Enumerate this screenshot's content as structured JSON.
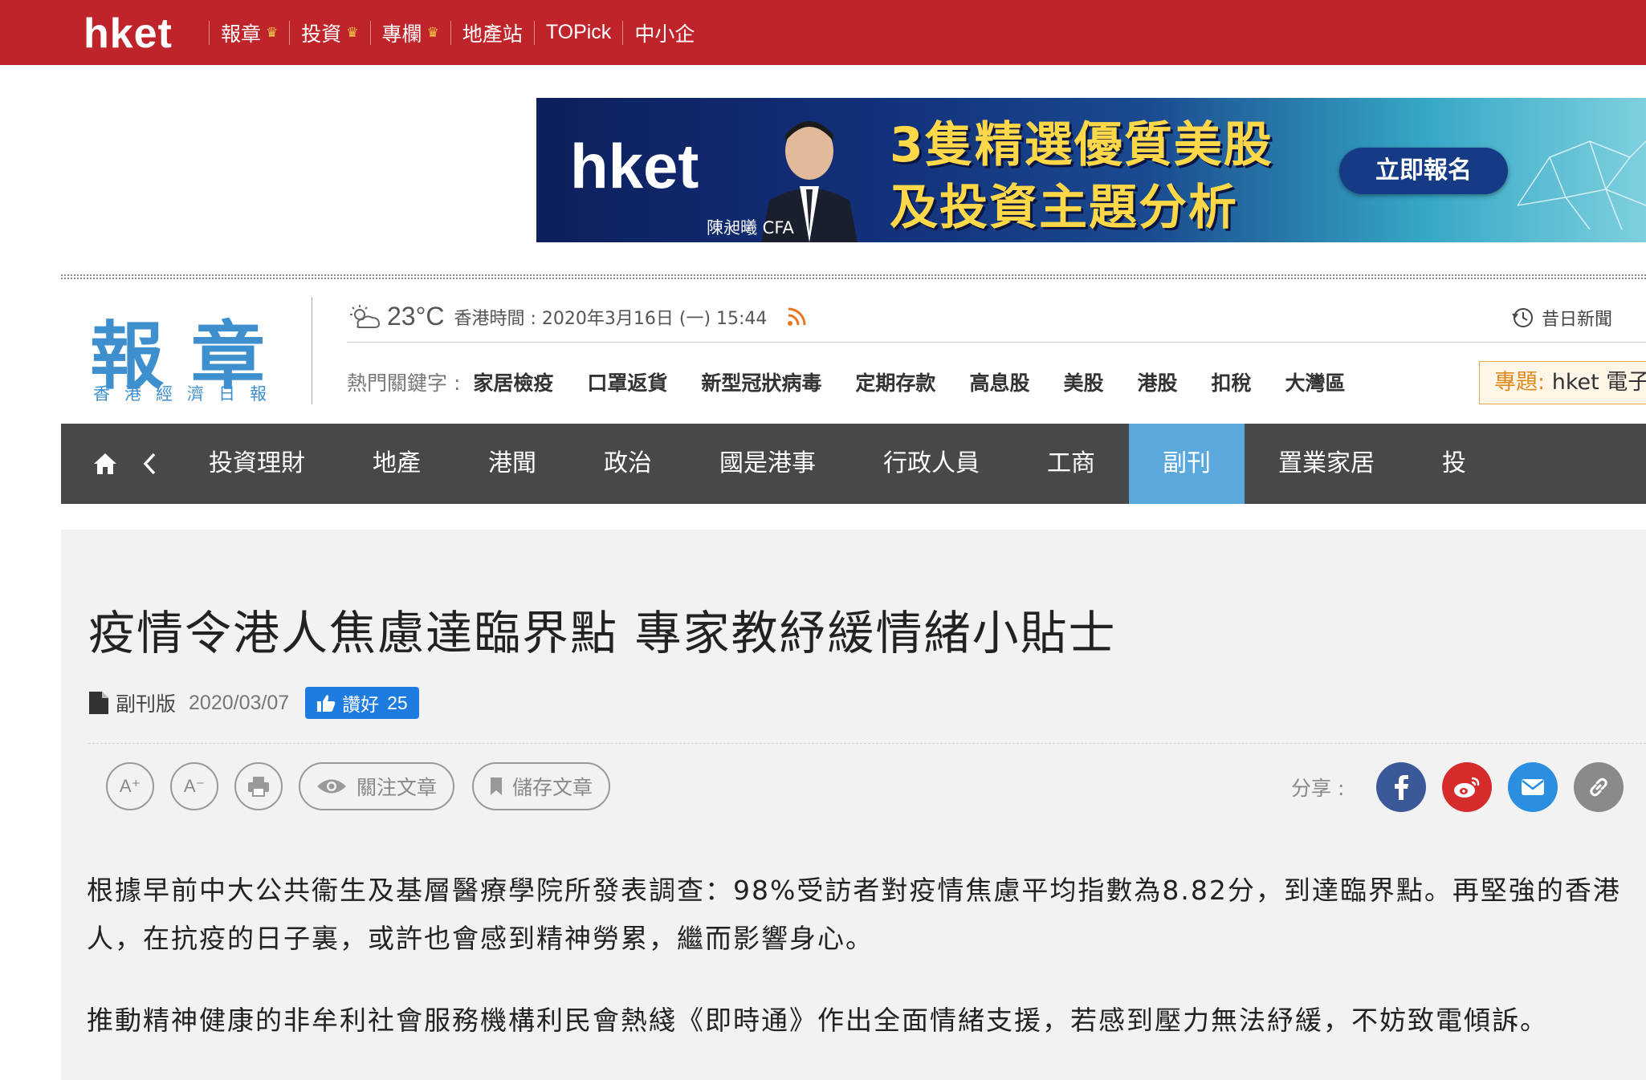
{
  "topbar": {
    "brand": "hket",
    "nav": [
      {
        "label": "報章",
        "crown": true
      },
      {
        "label": "投資",
        "crown": true
      },
      {
        "label": "專欄",
        "crown": true
      },
      {
        "label": "地產站",
        "crown": false
      },
      {
        "label": "TOPick",
        "crown": false
      },
      {
        "label": "中小企",
        "crown": false
      }
    ],
    "crown_icon": "crown-icon"
  },
  "ad": {
    "logo": "hket",
    "line1": "3隻精選優質美股",
    "line2": "及投資主題分析",
    "cta": "立即報名",
    "caption": "陳昶曦 CFA"
  },
  "header": {
    "paper_logo": "報章",
    "paper_sub": "香港經濟日報",
    "temperature": "23°C",
    "time": "香港時間 : 2020年3月16日 (一) 15:44",
    "past_news": "昔日新聞",
    "hot_label": "熱門關鍵字 :",
    "hot_keywords": [
      "家居檢疫",
      "口罩返貨",
      "新型冠狀病毒",
      "定期存款",
      "高息股",
      "美股",
      "港股",
      "扣稅",
      "大灣區"
    ],
    "topic_label": "專題:",
    "topic_value": "hket 電子"
  },
  "mainnav": {
    "items": [
      "投資理財",
      "地產",
      "港聞",
      "政治",
      "國是港事",
      "行政人員",
      "工商",
      "副刊",
      "置業家居",
      "投"
    ],
    "active_index": 7
  },
  "article": {
    "headline": "疫情令港人焦慮達臨界點 專家教紓緩情緒小貼士",
    "section": "副刊版",
    "date": "2020/03/07",
    "like_label": "讚好",
    "like_count": "25",
    "tools": {
      "font_up": "A⁺",
      "font_down": "A⁻",
      "follow": "關注文章",
      "save": "儲存文章"
    },
    "share_label": "分享 :",
    "paragraphs": [
      "根據早前中大公共衞生及基層醫療學院所發表調查：98%受訪者對疫情焦慮平均指數為8.82分，到達臨界點。再堅強的香港人，在抗疫的日子裏，或許也會感到精神勞累，繼而影響身心。",
      "推動精神健康的非牟利社會服務機構利民會熱綫《即時通》作出全面情緒支援，若感到壓力無法紓緩，不妨致電傾訴。"
    ]
  },
  "colors": {
    "topbar_red": "#c0242b",
    "logo_blue": "#3d8fce",
    "nav_dark": "#474849",
    "nav_active": "#5aa8dc",
    "facebook": "#3b5998",
    "weibo": "#d52b2b",
    "email": "#2a8fe0",
    "link": "#8a8a8a"
  }
}
